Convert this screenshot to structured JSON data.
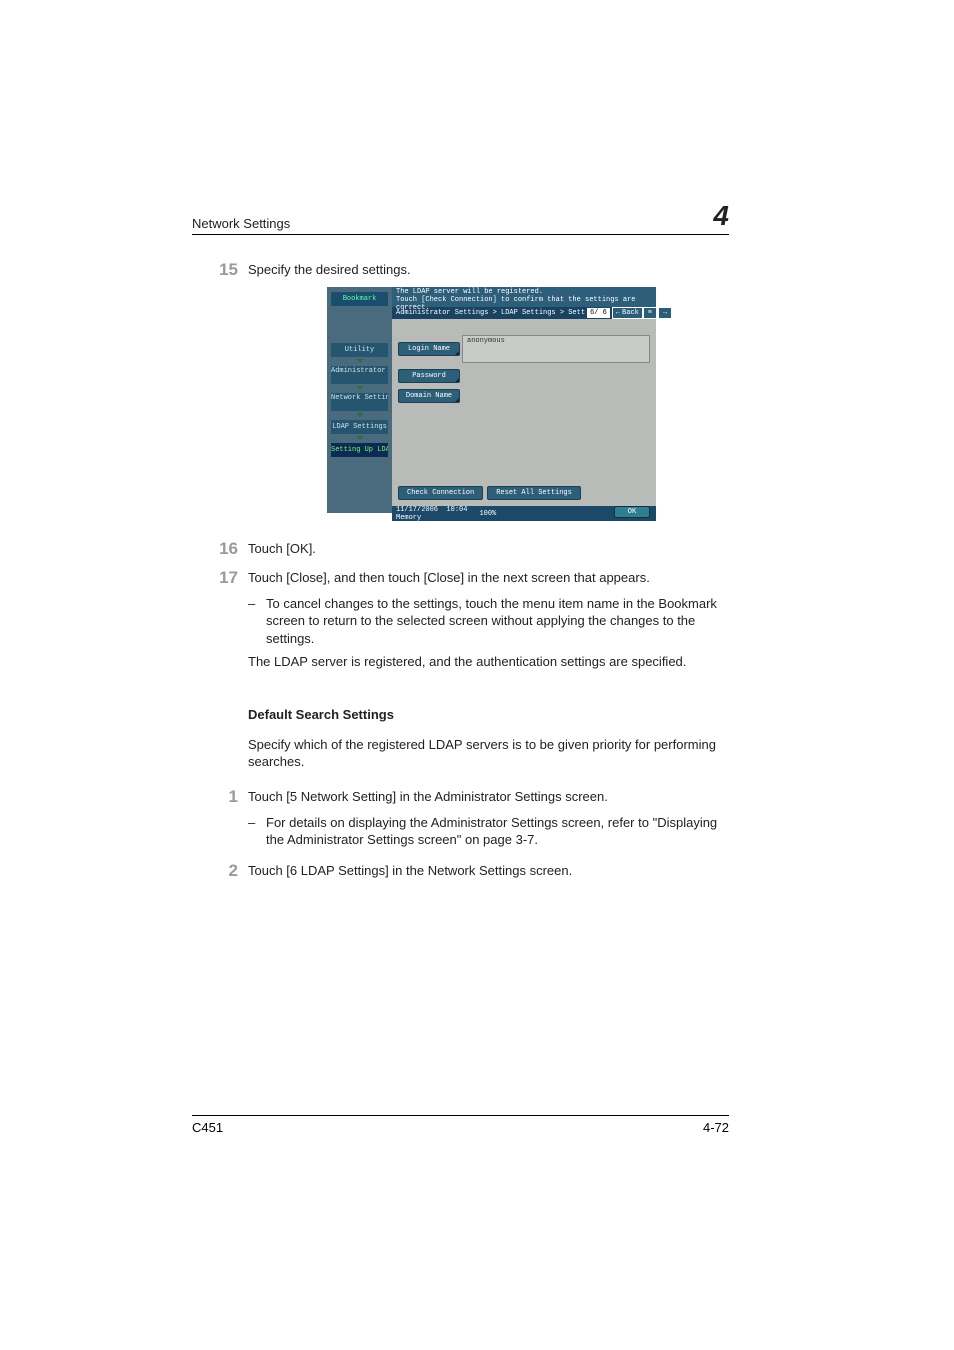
{
  "header": {
    "left": "Network Settings",
    "right": "4"
  },
  "steps": {
    "n15": "15",
    "t15": "Specify the desired settings.",
    "n16": "16",
    "t16": "Touch [OK].",
    "n17": "17",
    "t17": "Touch [Close], and then touch [Close] in the next screen that appears.",
    "b17": "To cancel changes to the settings, touch the menu item name in the Bookmark screen to return to the selected screen without applying the changes to the settings.",
    "post17": "The LDAP server is registered, and the authentication settings are specified."
  },
  "section": {
    "title": "Default Search Settings",
    "intro": "Specify which of the registered LDAP servers is to be given priority for performing searches.",
    "n1": "1",
    "t1": "Touch [5 Network Setting] in the Administrator Settings screen.",
    "b1": "For details on displaying the Administrator Settings screen, refer to \"Displaying the Administrator Settings screen\" on page 3-7.",
    "n2": "2",
    "t2": "Touch [6 LDAP Settings] in the Network Settings screen."
  },
  "footer": {
    "left": "C451",
    "right": "4-72"
  },
  "ss": {
    "titleLine1": "The LDAP server will be registered.",
    "titleLine2": "Touch [Check Connection] to confirm that the settings are correct.",
    "breadcrumb": "Administrator Settings > LDAP Settings > Sett",
    "pageIndicator": "6/ 6",
    "back": "Back",
    "bookmark": "Bookmark",
    "side": {
      "utility": "Utility",
      "admin": "Administrator Settings",
      "netset": "Network Settings",
      "ldap": "LDAP Settings",
      "setup": "Setting Up LDAP"
    },
    "fields": {
      "loginName": "Login Name",
      "loginValue": "anonymous",
      "password": "Password",
      "domain": "Domain Name"
    },
    "actions": {
      "check": "Check Connection",
      "reset": "Reset All Settings",
      "ok": "OK"
    },
    "status": {
      "date": "11/17/2006",
      "time": "10:04",
      "mem_label": "Memory",
      "mem_val": "100%"
    }
  }
}
